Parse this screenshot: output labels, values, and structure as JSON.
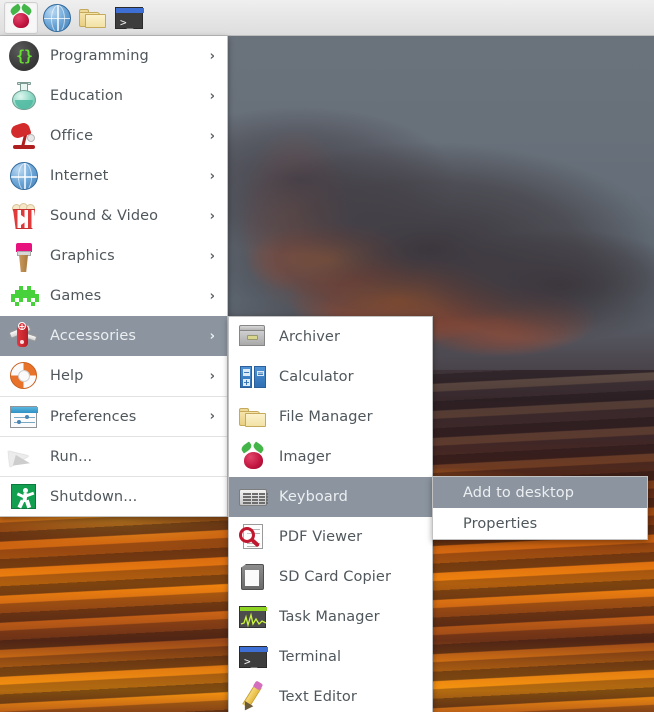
{
  "taskbar": {
    "items": [
      {
        "name": "menu-button",
        "icon": "raspberry-pi-logo-icon",
        "label": ""
      },
      {
        "name": "web-browser-launcher",
        "icon": "globe-icon",
        "label": ""
      },
      {
        "name": "file-manager-launcher",
        "icon": "folder-icon",
        "label": ""
      },
      {
        "name": "terminal-launcher",
        "icon": "terminal-icon",
        "label": ""
      }
    ]
  },
  "main_menu": {
    "items": [
      {
        "label": "Programming",
        "icon": "braces-icon",
        "arrow": "›",
        "has_submenu": true,
        "highlighted": false,
        "separator_above": false
      },
      {
        "label": "Education",
        "icon": "flask-icon",
        "arrow": "›",
        "has_submenu": true,
        "highlighted": false,
        "separator_above": false
      },
      {
        "label": "Office",
        "icon": "desk-lamp-icon",
        "arrow": "›",
        "has_submenu": true,
        "highlighted": false,
        "separator_above": false
      },
      {
        "label": "Internet",
        "icon": "globe-icon",
        "arrow": "›",
        "has_submenu": true,
        "highlighted": false,
        "separator_above": false
      },
      {
        "label": "Sound & Video",
        "icon": "popcorn-icon",
        "arrow": "›",
        "has_submenu": true,
        "highlighted": false,
        "separator_above": false
      },
      {
        "label": "Graphics",
        "icon": "paintbrush-icon",
        "arrow": "›",
        "has_submenu": true,
        "highlighted": false,
        "separator_above": false
      },
      {
        "label": "Games",
        "icon": "space-invader-icon",
        "arrow": "›",
        "has_submenu": true,
        "highlighted": false,
        "separator_above": false
      },
      {
        "label": "Accessories",
        "icon": "swiss-army-knife-icon",
        "arrow": "›",
        "has_submenu": true,
        "highlighted": true,
        "separator_above": false
      },
      {
        "label": "Help",
        "icon": "life-ring-icon",
        "arrow": "›",
        "has_submenu": true,
        "highlighted": false,
        "separator_above": false
      },
      {
        "label": "Preferences",
        "icon": "sliders-icon",
        "arrow": "›",
        "has_submenu": true,
        "highlighted": false,
        "separator_above": true
      },
      {
        "label": "Run...",
        "icon": "paper-plane-icon",
        "arrow": "",
        "has_submenu": false,
        "highlighted": false,
        "separator_above": true
      },
      {
        "label": "Shutdown...",
        "icon": "exit-sign-icon",
        "arrow": "",
        "has_submenu": false,
        "highlighted": false,
        "separator_above": true
      }
    ]
  },
  "sub_menu": {
    "parent": "Accessories",
    "items": [
      {
        "label": "Archiver",
        "icon": "file-drawer-icon",
        "highlighted": false
      },
      {
        "label": "Calculator",
        "icon": "calculator-icon",
        "highlighted": false
      },
      {
        "label": "File Manager",
        "icon": "folder-icon",
        "highlighted": false
      },
      {
        "label": "Imager",
        "icon": "raspberry-pi-icon",
        "highlighted": false
      },
      {
        "label": "Keyboard",
        "icon": "keyboard-icon",
        "highlighted": true
      },
      {
        "label": "PDF Viewer",
        "icon": "pdf-magnifier-icon",
        "highlighted": false
      },
      {
        "label": "SD Card Copier",
        "icon": "sd-card-icon",
        "highlighted": false
      },
      {
        "label": "Task Manager",
        "icon": "graph-monitor-icon",
        "highlighted": false
      },
      {
        "label": "Terminal",
        "icon": "terminal-icon",
        "highlighted": false
      },
      {
        "label": "Text Editor",
        "icon": "pencil-icon",
        "highlighted": false
      }
    ]
  },
  "context_menu": {
    "items": [
      {
        "label": "Add to desktop",
        "highlighted": true
      },
      {
        "label": "Properties",
        "highlighted": false
      }
    ]
  },
  "colors": {
    "menu_background": "#ffffff",
    "menu_border": "#c2c2c2",
    "highlight_background": "#8b949f",
    "highlight_text": "#eceff1",
    "menu_text": "#4f575c",
    "taskbar_background": "#e6e6e6",
    "separator": "#e2e2e2"
  },
  "desktop": {
    "wallpaper_description": "sunset sky with fiery orange clouds"
  }
}
